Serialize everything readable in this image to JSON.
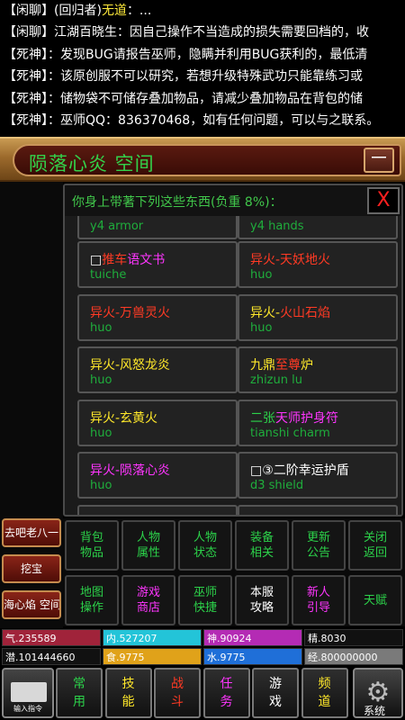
{
  "chat": [
    {
      "channel": "【闲聊】",
      "name": "(回归者)",
      "name_hl": "无道",
      "text": "：..."
    },
    {
      "channel": "【闲聊】",
      "name": "江湖百晓生",
      "name_hl": "",
      "text": "：因自己操作不当造成的损失需要回档的，收"
    },
    {
      "channel": "【死神】",
      "name": "",
      "name_hl": "",
      "text": "：发现BUG请报告巫师，隐瞒并利用BUG获利的，最低清"
    },
    {
      "channel": "【死神】",
      "name": "",
      "name_hl": "",
      "text": "：该原创服不可以研究，若想升级特殊武功只能靠练习或"
    },
    {
      "channel": "【死神】",
      "name": "",
      "name_hl": "",
      "text": "：储物袋不可储存叠加物品，请减少叠加物品在背包的储"
    },
    {
      "channel": "【死神】",
      "name": "",
      "name_hl": "",
      "text": "：巫师QQ：836370468，如有任何问题，可以与之联系。"
    }
  ],
  "location": {
    "title": "陨落心炎 空间",
    "collapse_label": "－"
  },
  "side_buttons": [
    "去吧老八一",
    "挖宝",
    "海心焰 空间"
  ],
  "inventory": {
    "title": "你身上带著下列这些东西(负重 8%)：",
    "close_label": "X",
    "partial_top": [
      {
        "parts": [
          {
            "t": "",
            "c": "c-wht"
          }
        ],
        "id": "y4 armor"
      },
      {
        "parts": [
          {
            "t": "",
            "c": "c-wht"
          }
        ],
        "id": "y4 hands"
      }
    ],
    "items": [
      {
        "prefix": "□",
        "parts": [
          {
            "t": "推车",
            "c": "c-red"
          },
          {
            "t": "语文书",
            "c": "c-mag"
          }
        ],
        "id": "tuiche"
      },
      {
        "prefix": "",
        "parts": [
          {
            "t": "异火-天妖地火",
            "c": "c-red"
          }
        ],
        "id": "huo"
      },
      {
        "prefix": "",
        "parts": [
          {
            "t": "异火-万兽灵火",
            "c": "c-red"
          }
        ],
        "id": "huo"
      },
      {
        "prefix": "",
        "parts": [
          {
            "t": "异火-",
            "c": "c-yel"
          },
          {
            "t": "火山石焰",
            "c": "c-red"
          }
        ],
        "id": "huo"
      },
      {
        "prefix": "",
        "parts": [
          {
            "t": "异火-风怒龙炎",
            "c": "c-yel"
          }
        ],
        "id": "huo"
      },
      {
        "prefix": "",
        "parts": [
          {
            "t": "九鼎",
            "c": "c-yel"
          },
          {
            "t": "至尊",
            "c": "c-red"
          },
          {
            "t": "炉",
            "c": "c-yel"
          }
        ],
        "id": "zhizun lu"
      },
      {
        "prefix": "",
        "parts": [
          {
            "t": "异火-玄黄火",
            "c": "c-yel"
          }
        ],
        "id": "huo"
      },
      {
        "prefix": "",
        "parts": [
          {
            "t": "二张",
            "c": "c-grn"
          },
          {
            "t": "天师护身符",
            "c": "c-mag"
          }
        ],
        "id": "tianshi charm"
      },
      {
        "prefix": "",
        "parts": [
          {
            "t": "异火-陨落心炎",
            "c": "c-mag"
          }
        ],
        "id": "huo"
      },
      {
        "prefix": "□③",
        "parts": [
          {
            "t": "二阶幸运护盾",
            "c": "c-wht"
          }
        ],
        "id": "d3 shield"
      }
    ]
  },
  "menu": [
    {
      "l1": "背包",
      "l2": "物品",
      "c": "c-grn"
    },
    {
      "l1": "人物",
      "l2": "属性",
      "c": "c-grn"
    },
    {
      "l1": "人物",
      "l2": "状态",
      "c": "c-grn"
    },
    {
      "l1": "装备",
      "l2": "相关",
      "c": "c-grn"
    },
    {
      "l1": "更新",
      "l2": "公告",
      "c": "c-grn"
    },
    {
      "l1": "关闭",
      "l2": "返回",
      "c": "c-grn"
    },
    {
      "l1": "地图",
      "l2": "操作",
      "c": "c-grn"
    },
    {
      "l1": "游戏",
      "l2": "商店",
      "c": "c-mag"
    },
    {
      "l1": "巫师",
      "l2": "快捷",
      "c": "c-grn"
    },
    {
      "l1": "本服",
      "l2": "攻略",
      "c": "c-wht"
    },
    {
      "l1": "新人",
      "l2": "引导",
      "c": "c-mag"
    },
    {
      "l1": "天赋",
      "l2": "",
      "c": "c-grn"
    }
  ],
  "stats": [
    {
      "label": "气.235589",
      "bg": "#a0233a",
      "fg": "#ffffff",
      "fill": 1.0
    },
    {
      "label": "内.527207",
      "bg": "#23c4d8",
      "fg": "#ffffff",
      "fill": 1.0
    },
    {
      "label": "神.90924",
      "bg": "#b42bb4",
      "fg": "#ffffff",
      "fill": 1.0
    },
    {
      "label": "精.8030",
      "bg": "#111111",
      "fg": "#ffffff",
      "fill": 1.0
    },
    {
      "label": "潜.101444660",
      "bg": "#111111",
      "fg": "#ffffff",
      "fill": 1.0
    },
    {
      "label": "食.9775",
      "bg": "#e0a21a",
      "fg": "#ffffff",
      "fill": 1.0
    },
    {
      "label": "水.9775",
      "bg": "#1f6fd8",
      "fg": "#ffffff",
      "fill": 1.0
    },
    {
      "label": "经.800000000",
      "bg": "#7a7a7a",
      "fg": "#ffffff",
      "fill": 1.0
    }
  ],
  "bottom_nav": {
    "input_label": "输入指令",
    "tabs": [
      {
        "l1": "常",
        "l2": "用",
        "c": "c-grn"
      },
      {
        "l1": "技",
        "l2": "能",
        "c": "c-yel"
      },
      {
        "l1": "战",
        "l2": "斗",
        "c": "c-red"
      },
      {
        "l1": "任",
        "l2": "务",
        "c": "c-mag"
      },
      {
        "l1": "游",
        "l2": "戏",
        "c": "c-wht"
      },
      {
        "l1": "频",
        "l2": "道",
        "c": "c-yel"
      }
    ],
    "settings_label": "系统"
  }
}
